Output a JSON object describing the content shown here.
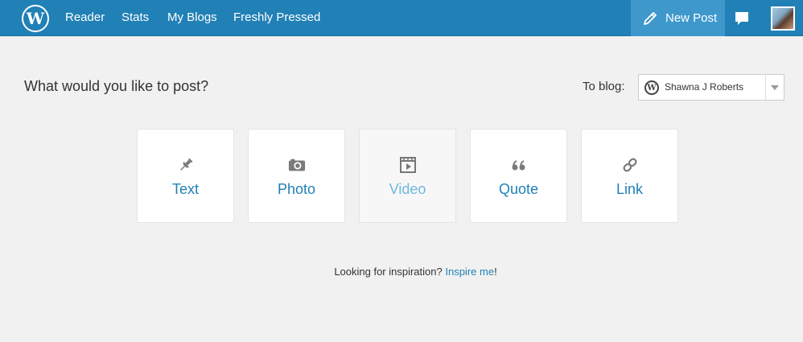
{
  "topbar": {
    "logo_letter": "W",
    "nav": [
      {
        "label": "Reader"
      },
      {
        "label": "Stats"
      },
      {
        "label": "My Blogs"
      },
      {
        "label": "Freshly Pressed"
      }
    ],
    "new_post_label": "New Post",
    "accent_color": "#2180b6"
  },
  "main": {
    "prompt": "What would you like to post?",
    "to_blog_label": "To blog:",
    "selected_blog": "Shawna J Roberts",
    "post_types": [
      {
        "label": "Text",
        "icon": "pin-icon"
      },
      {
        "label": "Photo",
        "icon": "camera-icon"
      },
      {
        "label": "Video",
        "icon": "video-icon",
        "disabled": true
      },
      {
        "label": "Quote",
        "icon": "quote-icon"
      },
      {
        "label": "Link",
        "icon": "link-icon"
      }
    ],
    "inspiration_text": "Looking for inspiration?",
    "inspire_link": "Inspire me",
    "inspire_suffix": "!"
  }
}
